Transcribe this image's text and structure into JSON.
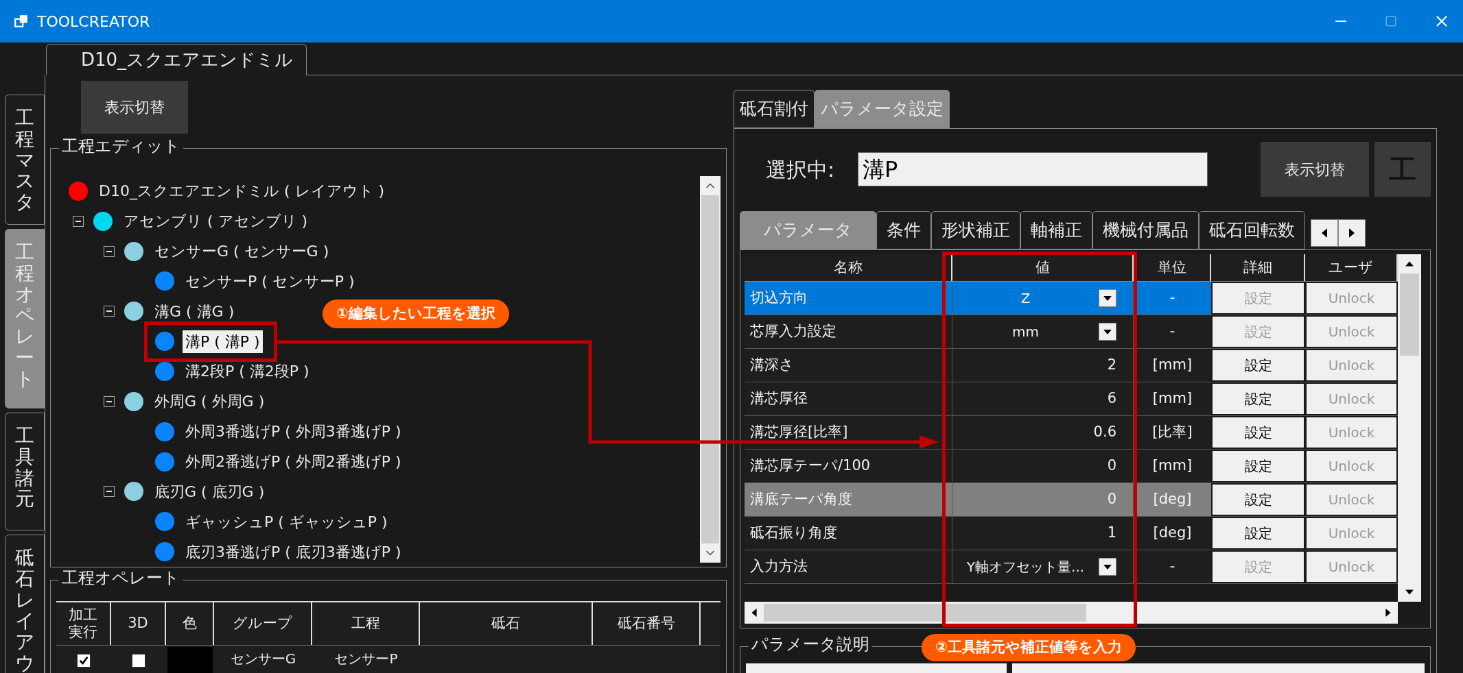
{
  "window": {
    "title": "TOOLCREATOR"
  },
  "side_tabs": [
    {
      "label": "工程マスタ",
      "selected": false
    },
    {
      "label": "工程オペレート",
      "selected": true
    },
    {
      "label": "工具諸元",
      "selected": false
    },
    {
      "label": "砥石レイアウ",
      "selected": false
    }
  ],
  "document_tab": {
    "label": "D10_スクエアエンドミル"
  },
  "left": {
    "toggle_button": "表示切替",
    "process_edit": {
      "title": "工程エディット",
      "tree": [
        {
          "label": "D10_スクエアエンドミル ( レイアウト )",
          "color": "#ff0000",
          "selected": false,
          "children": [
            {
              "label": "アセンブリ ( アセンブリ )",
              "color": "#00d8f0",
              "selected": false,
              "expanded": true,
              "children": [
                {
                  "label": "センサーG ( センサーG )",
                  "color": "#8ccfe0",
                  "selected": false,
                  "expanded": true,
                  "children": [
                    {
                      "label": "センサーP ( センサーP )",
                      "color": "#0a84ff",
                      "selected": false
                    }
                  ]
                },
                {
                  "label": "溝G ( 溝G )",
                  "color": "#8ccfe0",
                  "selected": false,
                  "expanded": true,
                  "children": [
                    {
                      "label": "溝P ( 溝P )",
                      "color": "#0a84ff",
                      "selected": true
                    },
                    {
                      "label": "溝2段P ( 溝2段P )",
                      "color": "#0a84ff",
                      "selected": false
                    }
                  ]
                },
                {
                  "label": "外周G ( 外周G )",
                  "color": "#8ccfe0",
                  "selected": false,
                  "expanded": true,
                  "children": [
                    {
                      "label": "外周3番逃げP ( 外周3番逃げP )",
                      "color": "#0a84ff",
                      "selected": false
                    },
                    {
                      "label": "外周2番逃げP ( 外周2番逃げP )",
                      "color": "#0a84ff",
                      "selected": false
                    }
                  ]
                },
                {
                  "label": "底刃G ( 底刃G )",
                  "color": "#8ccfe0",
                  "selected": false,
                  "expanded": true,
                  "children": [
                    {
                      "label": "ギャッシュP ( ギャッシュP )",
                      "color": "#0a84ff",
                      "selected": false
                    },
                    {
                      "label": "底刃3番逃げP ( 底刃3番逃げP )",
                      "color": "#0a84ff",
                      "selected": false
                    }
                  ]
                }
              ]
            }
          ]
        }
      ]
    },
    "process_operate": {
      "title": "工程オペレート",
      "columns": [
        "加工実行",
        "3D",
        "色",
        "グループ",
        "工程",
        "砥石",
        "砥石番号"
      ],
      "rows": [
        {
          "run": true,
          "view_3d": false,
          "color": "#000000",
          "group": "センサーG",
          "process": "センサーP"
        }
      ]
    }
  },
  "right": {
    "tabs": [
      {
        "label": "砥石割付",
        "selected": false
      },
      {
        "label": "パラメータ設定",
        "selected": true
      }
    ],
    "selection_label": "選択中:",
    "selection_value": "溝P",
    "toggle_button": "表示切替",
    "icon_button": "工",
    "param_tabs": [
      {
        "label": "パラメータ",
        "selected": true
      },
      {
        "label": "条件",
        "selected": false
      },
      {
        "label": "形状補正",
        "selected": false
      },
      {
        "label": "軸補正",
        "selected": false
      },
      {
        "label": "機械付属品",
        "selected": false
      },
      {
        "label": "砥石回転数",
        "selected": false
      }
    ],
    "columns": [
      "名称",
      "値",
      "単位",
      "詳細",
      "ユーザ"
    ],
    "rows": [
      {
        "name": "切込方向",
        "value": "Z",
        "kind": "dropdown",
        "unit": "-",
        "detail": "設定",
        "detail_enabled": false,
        "user": "Unlock",
        "selected": true,
        "disabled": false
      },
      {
        "name": "芯厚入力設定",
        "value": "mm",
        "kind": "dropdown",
        "unit": "-",
        "detail": "設定",
        "detail_enabled": false,
        "user": "Unlock",
        "selected": false,
        "disabled": false
      },
      {
        "name": "溝深さ",
        "value": "2",
        "kind": "number",
        "unit": "[mm]",
        "detail": "設定",
        "detail_enabled": true,
        "user": "Unlock",
        "selected": false,
        "disabled": false
      },
      {
        "name": "溝芯厚径",
        "value": "6",
        "kind": "number",
        "unit": "[mm]",
        "detail": "設定",
        "detail_enabled": true,
        "user": "Unlock",
        "selected": false,
        "disabled": false
      },
      {
        "name": "溝芯厚径[比率]",
        "value": "0.6",
        "kind": "number",
        "unit": "[比率]",
        "detail": "設定",
        "detail_enabled": true,
        "user": "Unlock",
        "selected": false,
        "disabled": false
      },
      {
        "name": "溝芯厚テーパ/100",
        "value": "0",
        "kind": "number",
        "unit": "[mm]",
        "detail": "設定",
        "detail_enabled": true,
        "user": "Unlock",
        "selected": false,
        "disabled": false
      },
      {
        "name": "溝底テーパ角度",
        "value": "0",
        "kind": "number",
        "unit": "[deg]",
        "detail": "設定",
        "detail_enabled": true,
        "user": "Unlock",
        "selected": false,
        "disabled": true
      },
      {
        "name": "砥石振り角度",
        "value": "1",
        "kind": "number",
        "unit": "[deg]",
        "detail": "設定",
        "detail_enabled": true,
        "user": "Unlock",
        "selected": false,
        "disabled": false
      },
      {
        "name": "入力方法",
        "value": "Y軸オフセット量...",
        "kind": "dropdown",
        "unit": "-",
        "detail": "設定",
        "detail_enabled": false,
        "user": "Unlock",
        "selected": false,
        "disabled": false
      }
    ],
    "description_title": "パラメータ説明"
  },
  "annotations": [
    {
      "text": "①編集したい工程を選択"
    },
    {
      "text": "②工具諸元や補正値等を入力"
    }
  ]
}
